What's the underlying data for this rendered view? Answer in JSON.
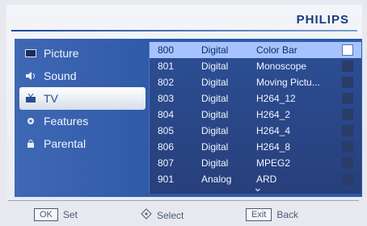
{
  "brand": "PHILIPS",
  "sidebar": {
    "items": [
      {
        "label": "Picture",
        "icon": "picture-icon"
      },
      {
        "label": "Sound",
        "icon": "speaker-icon"
      },
      {
        "label": "TV",
        "icon": "tv-antenna-icon",
        "selected": true
      },
      {
        "label": "Features",
        "icon": "gear-icon"
      },
      {
        "label": "Parental",
        "icon": "lock-icon"
      }
    ]
  },
  "channels": [
    {
      "num": "800",
      "type": "Digital",
      "name": "Color Bar",
      "highlight": true
    },
    {
      "num": "801",
      "type": "Digital",
      "name": "Monoscope"
    },
    {
      "num": "802",
      "type": "Digital",
      "name": "Moving Pictu..."
    },
    {
      "num": "803",
      "type": "Digital",
      "name": "H264_12"
    },
    {
      "num": "804",
      "type": "Digital",
      "name": "H264_2"
    },
    {
      "num": "805",
      "type": "Digital",
      "name": "H264_4"
    },
    {
      "num": "806",
      "type": "Digital",
      "name": "H264_8"
    },
    {
      "num": "807",
      "type": "Digital",
      "name": "MPEG2"
    },
    {
      "num": "901",
      "type": "Analog",
      "name": "ARD"
    }
  ],
  "footer": {
    "ok_key": "OK",
    "ok_label": "Set",
    "select_label": "Select",
    "exit_key": "Exit",
    "exit_label": "Back"
  },
  "colors": {
    "panel_blue": "#2f5aa8",
    "highlight": "#a7c3ff",
    "brand": "#173c7f"
  }
}
